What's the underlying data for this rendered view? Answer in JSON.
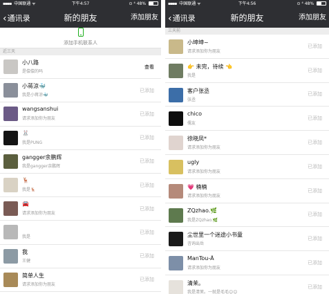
{
  "left_screen": {
    "status_bar": {
      "signal": "▪▪▪▪",
      "carrier": "中国联通",
      "wifi": "ᯤ",
      "time": "下午4:57",
      "indicators": "⊙ ⁴ 48%",
      "battery_level": 0.48
    },
    "nav": {
      "back_label": "通讯录",
      "title": "新的朋友",
      "action": "添加朋友"
    },
    "add_phone_label": "添加手机联系人",
    "section_label": "近三天",
    "rows": [
      {
        "name": "小八路",
        "message": "是偿偿的吗",
        "status": "查看",
        "avatar_color": "#c9c7c4"
      },
      {
        "name": "小蒋涼🐳",
        "message": "我是小蒋涼🐳",
        "status": "已添加",
        "avatar_color": "#8a8f9a"
      },
      {
        "name": "wangsanshui",
        "message": "请求添加你为朋友",
        "status": "已添加",
        "avatar_color": "#6b5a86"
      },
      {
        "name": "🐰",
        "message": "我是PUNG",
        "status": "已添加",
        "avatar_color": "#141414"
      },
      {
        "name": "gangger余鹏辉",
        "message": "我是gangger余鹏辉",
        "status": "已添加",
        "avatar_color": "#5b5f3e"
      },
      {
        "name": "🦌",
        "message": "我是🦌",
        "status": "已添加",
        "avatar_color": "#d9d2c4"
      },
      {
        "name": "🚘",
        "message": "请求添加你为朋友",
        "status": "已添加",
        "avatar_color": "#7a5b55"
      },
      {
        "name": "",
        "message": "我是",
        "status": "已添加",
        "avatar_color": "#b8b8b8"
      },
      {
        "name": "我",
        "message": "王健",
        "status": "已添加",
        "avatar_color": "#8c9aa4"
      },
      {
        "name": "简单人生",
        "message": "请求添加你为朋友",
        "status": "已添加",
        "avatar_color": "#a88a58"
      }
    ]
  },
  "right_screen": {
    "status_bar": {
      "signal": "▪▪▪▪",
      "carrier": "中国联通",
      "wifi": "ᯤ",
      "time": "下午4:56",
      "indicators": "⊙ ⁴ 48%",
      "battery_level": 0.48
    },
    "nav": {
      "back_label": "通讯录",
      "title": "新的朋友",
      "action": "添加朋友"
    },
    "section_label": "三天前",
    "rows": [
      {
        "name": "小坤坤~",
        "message": "请求添加你为朋友",
        "status": "已添加",
        "avatar_color": "#c9b98a"
      },
      {
        "name": "👉 未完，待续 👈",
        "message": "我是",
        "status": "已添加",
        "avatar_color": "#6f7c62"
      },
      {
        "name": "客户张丞",
        "message": "张丞",
        "status": "已添加",
        "avatar_color": "#3c6ea8"
      },
      {
        "name": "chico",
        "message": "儒友",
        "status": "已添加",
        "avatar_color": "#0d0d0d"
      },
      {
        "name": "徐晓凤*",
        "message": "请求添加你为朋友",
        "status": "已添加",
        "avatar_color": "#e0d4cf"
      },
      {
        "name": "ugly",
        "message": "请求添加你为朋友",
        "status": "已添加",
        "avatar_color": "#d8c060"
      },
      {
        "name": "💗 楠楠",
        "message": "请求添加你为朋友",
        "status": "已添加",
        "avatar_color": "#b58a7a"
      },
      {
        "name": "ZQzhao.🌿",
        "message": "我是ZQzhao.🌿",
        "status": "已添加",
        "avatar_color": "#5e7a4e"
      },
      {
        "name": "尘世里一个迷途小书童",
        "message": "咨询出岳",
        "status": "已添加",
        "avatar_color": "#1a1a1a"
      },
      {
        "name": "ManTou-Ä",
        "message": "请求添加你为朋友",
        "status": "已添加",
        "avatar_color": "#7d8fa8"
      },
      {
        "name": "清茉。",
        "message": "我是清茉。一就是毛毛😊😊",
        "status": "已添加",
        "avatar_color": "#e6e2dc"
      }
    ]
  }
}
